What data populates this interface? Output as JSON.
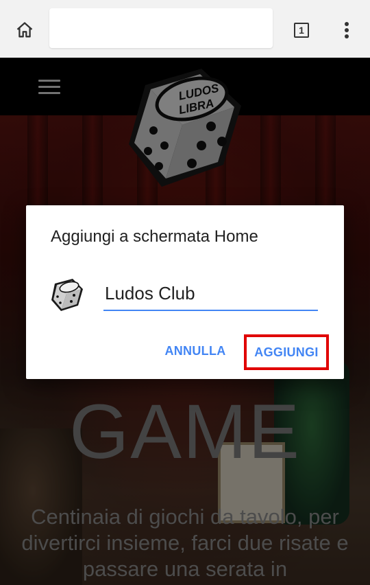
{
  "browser": {
    "url_text": "",
    "tab_count": "1"
  },
  "site": {
    "logo_text_top": "LUDOS",
    "logo_text_bottom": "LIBRA",
    "hero_title": "GAME",
    "hero_text": "Centinaia di giochi da tavolo, per divertirci insieme, farci due risate e passare una serata in"
  },
  "dialog": {
    "title": "Aggiungi a schermata Home",
    "shortcut_name": "Ludos Club",
    "cancel_label": "ANNULLA",
    "add_label": "AGGIUNGI"
  },
  "colors": {
    "accent": "#4285f4",
    "highlight_box": "#e00000"
  },
  "icons": [
    "home-icon",
    "tab-switcher-icon",
    "overflow-menu-icon",
    "hamburger-menu-icon",
    "ludos-libra-dice-logo"
  ]
}
